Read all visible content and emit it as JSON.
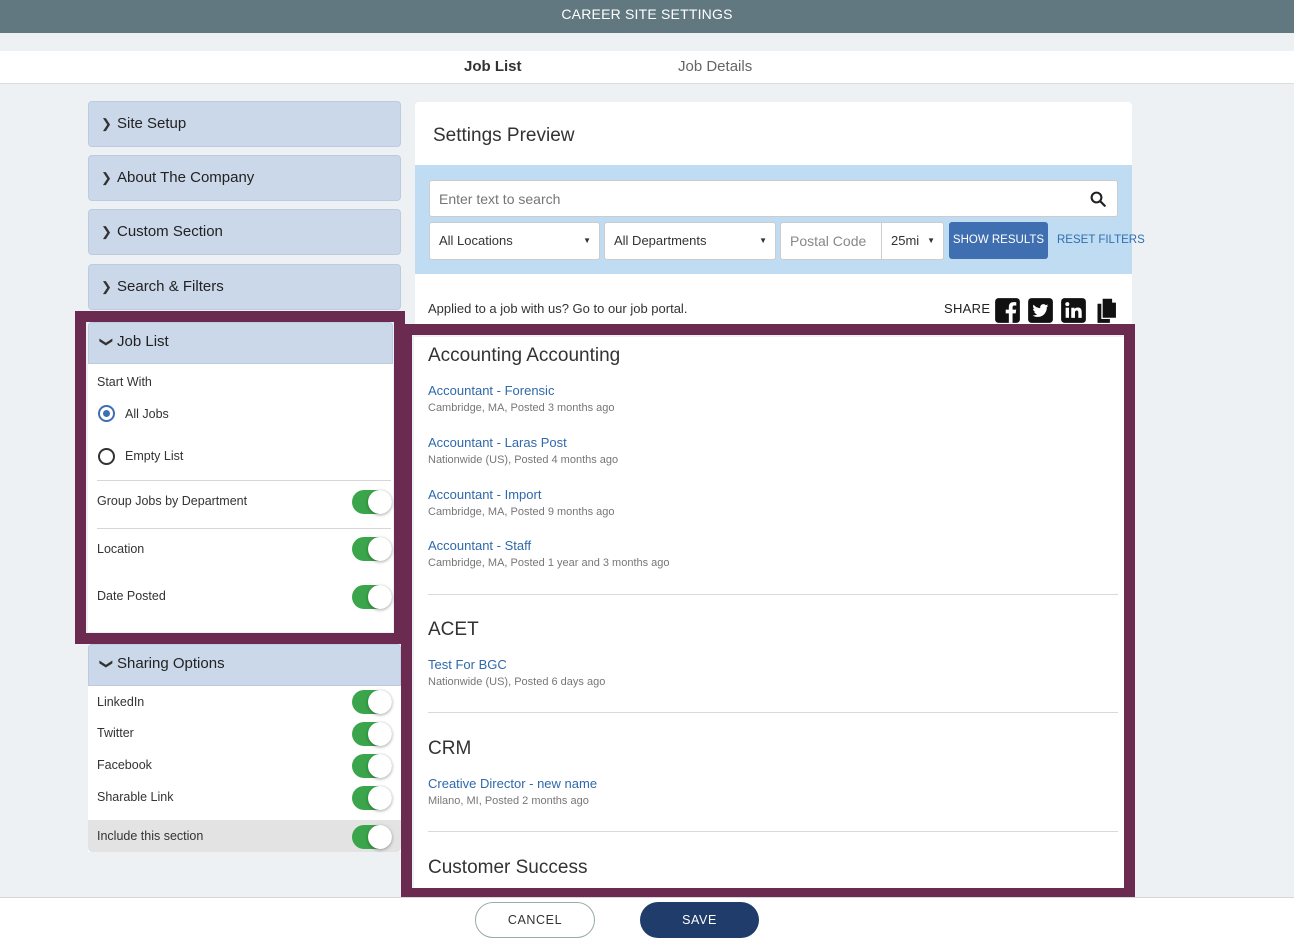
{
  "header": {
    "title": "CAREER SITE SETTINGS"
  },
  "tabs": [
    {
      "label": "Job List",
      "active": true
    },
    {
      "label": "Job Details",
      "active": false
    }
  ],
  "sidebar": {
    "sections": [
      {
        "label": "Site Setup",
        "expanded": false
      },
      {
        "label": "About The Company",
        "expanded": false
      },
      {
        "label": "Custom Section",
        "expanded": false
      },
      {
        "label": "Search & Filters",
        "expanded": false
      },
      {
        "label": "Job List",
        "expanded": true
      },
      {
        "label": "Sharing Options",
        "expanded": true
      }
    ],
    "job_list": {
      "start_with_label": "Start With",
      "options": [
        {
          "label": "All Jobs",
          "checked": true
        },
        {
          "label": "Empty List",
          "checked": false
        }
      ],
      "toggles": [
        {
          "label": "Group Jobs by Department",
          "on": true
        },
        {
          "label": "Location",
          "on": true
        },
        {
          "label": "Date Posted",
          "on": true
        }
      ]
    },
    "sharing": {
      "toggles": [
        {
          "label": "LinkedIn",
          "on": true
        },
        {
          "label": "Twitter",
          "on": true
        },
        {
          "label": "Facebook",
          "on": true
        },
        {
          "label": "Sharable Link",
          "on": true
        }
      ],
      "include_label": "Include this section",
      "include_on": true
    }
  },
  "preview": {
    "title": "Settings Preview",
    "search": {
      "placeholder": "Enter text to search",
      "location_select": "All Locations",
      "department_select": "All Departments",
      "postal_placeholder": "Postal Code",
      "radius_select": "25mi",
      "show_results_label": "SHOW RESULTS",
      "reset_filters_label": "RESET FILTERS"
    },
    "applied_text": "Applied to a job with us? Go to our job portal.",
    "share_label": "SHARE",
    "share_icons": [
      "facebook-icon",
      "twitter-icon",
      "linkedin-icon",
      "copy-icon"
    ],
    "departments": [
      {
        "name": "Accounting Accounting",
        "jobs": [
          {
            "title": "Accountant - Forensic",
            "meta": "Cambridge, MA, Posted 3 months ago"
          },
          {
            "title": "Accountant - Laras Post",
            "meta": "Nationwide (US), Posted 4 months ago"
          },
          {
            "title": "Accountant - Import",
            "meta": "Cambridge, MA, Posted 9 months ago"
          },
          {
            "title": "Accountant - Staff",
            "meta": "Cambridge, MA, Posted 1 year and 3 months ago"
          }
        ]
      },
      {
        "name": "ACET",
        "jobs": [
          {
            "title": "Test For BGC",
            "meta": "Nationwide (US), Posted 6 days ago"
          }
        ]
      },
      {
        "name": "CRM",
        "jobs": [
          {
            "title": "Creative Director - new name",
            "meta": "Milano, MI, Posted 2 months ago"
          }
        ]
      },
      {
        "name": "Customer Success",
        "jobs": []
      }
    ]
  },
  "footer": {
    "cancel_label": "CANCEL",
    "save_label": "SAVE"
  },
  "colors": {
    "header_bg": "#617880",
    "accent_blue": "#3f6fb0",
    "toggle_on": "#3aa54a",
    "highlight": "#6b2a4f",
    "save_bg": "#1f3c6b"
  }
}
